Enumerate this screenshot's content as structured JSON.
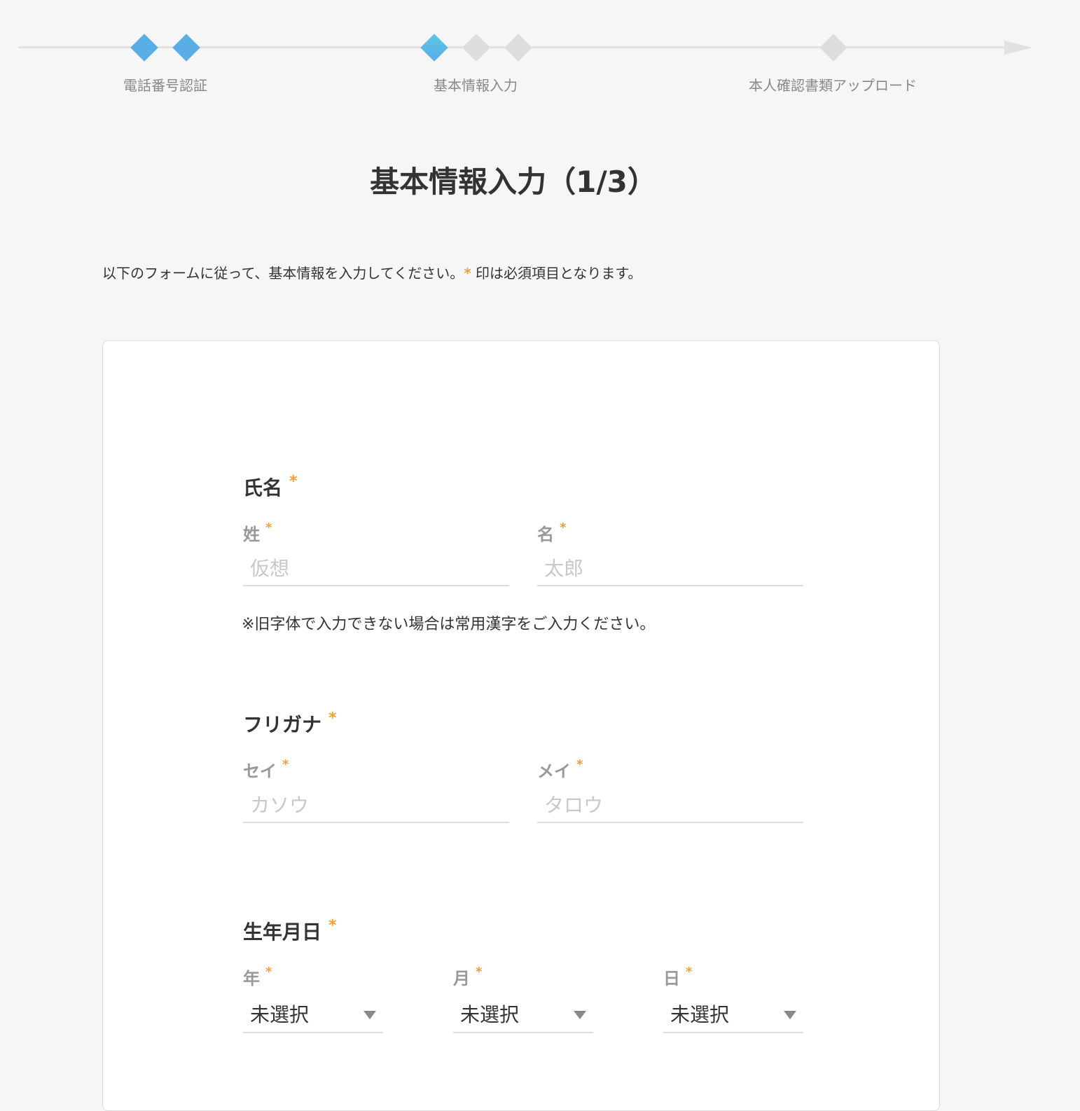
{
  "progress": {
    "steps": [
      {
        "label": "電話番号認証",
        "state": "done"
      },
      {
        "label": "基本情報入力",
        "state": "current"
      },
      {
        "label": "本人確認書類アップロード",
        "state": "todo"
      }
    ],
    "colors": {
      "done": "#5aaee6",
      "current": "#5ac8e6",
      "todo": "#dddddd",
      "line": "#e2e2e2"
    }
  },
  "page": {
    "title": "基本情報入力（1/3）",
    "instructions_before": "以下のフォームに従って、基本情報を入力してください。",
    "required_mark": "*",
    "instructions_after": " 印は必須項目となります。"
  },
  "form": {
    "name": {
      "title": "氏名",
      "last": {
        "label": "姓",
        "placeholder": "仮想",
        "value": ""
      },
      "first": {
        "label": "名",
        "placeholder": "太郎",
        "value": ""
      },
      "note": "※旧字体で入力できない場合は常用漢字をご入力ください。"
    },
    "kana": {
      "title": "フリガナ",
      "last": {
        "label": "セイ",
        "placeholder": "カソウ",
        "value": ""
      },
      "first": {
        "label": "メイ",
        "placeholder": "タロウ",
        "value": ""
      }
    },
    "birthdate": {
      "title": "生年月日",
      "year": {
        "label": "年",
        "selected": "未選択"
      },
      "month": {
        "label": "月",
        "selected": "未選択"
      },
      "day": {
        "label": "日",
        "selected": "未選択"
      }
    }
  },
  "colors": {
    "required": "#f0a030",
    "background": "#f6f6f6",
    "card": "#ffffff"
  }
}
